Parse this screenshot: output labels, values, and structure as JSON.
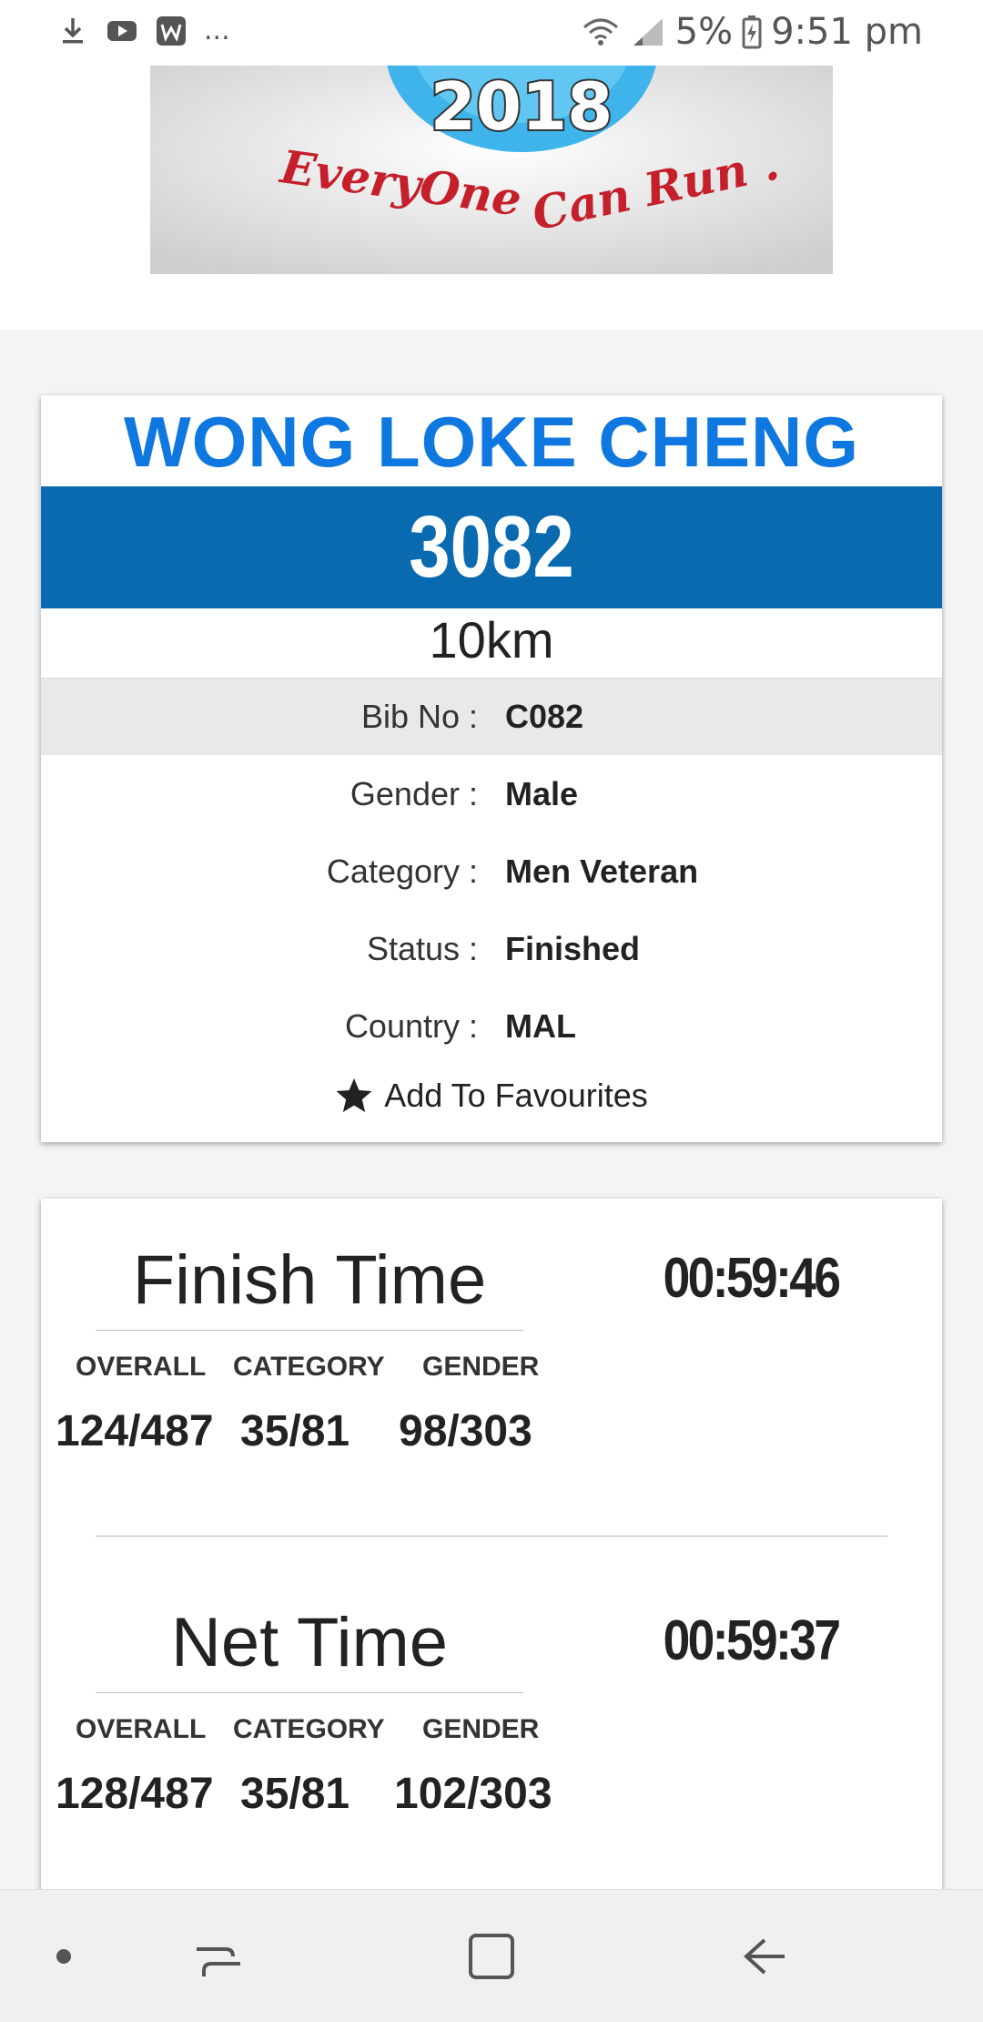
{
  "status_bar": {
    "notification_icons": [
      "download-icon",
      "youtube-icon",
      "w-app-icon"
    ],
    "more_indicator": "...",
    "battery": "5%",
    "time": "9:51 pm"
  },
  "runner": {
    "name": "WONG LOKE CHENG",
    "bib_display": "3082",
    "distance": "10km"
  },
  "details": [
    {
      "label": "Bib No :",
      "value": "C082"
    },
    {
      "label": "Gender :",
      "value": "Male"
    },
    {
      "label": "Category :",
      "value": "Men Veteran"
    },
    {
      "label": "Status :",
      "value": "Finished"
    },
    {
      "label": "Country :",
      "value": "MAL"
    }
  ],
  "favourites": {
    "label": "Add To Favourites",
    "icon": "star-icon"
  },
  "results": {
    "finish": {
      "title": "Finish Time",
      "time": "00:59:46",
      "headers": {
        "overall": "OVERALL",
        "category": "CATEGORY",
        "gender": "GENDER"
      },
      "overall": "124/487",
      "category": "35/81",
      "gender": "98/303"
    },
    "net": {
      "title": "Net Time",
      "time": "00:59:37",
      "headers": {
        "overall": "OVERALL",
        "category": "CATEGORY",
        "gender": "GENDER"
      },
      "overall": "128/487",
      "category": "35/81",
      "gender": "102/303"
    }
  },
  "colors": {
    "accent": "#0f78e0",
    "bib_band": "#0a6ab0"
  },
  "nav_bar": {
    "buttons": [
      "dot-icon",
      "recent-apps-icon",
      "home-icon",
      "back-icon"
    ]
  }
}
